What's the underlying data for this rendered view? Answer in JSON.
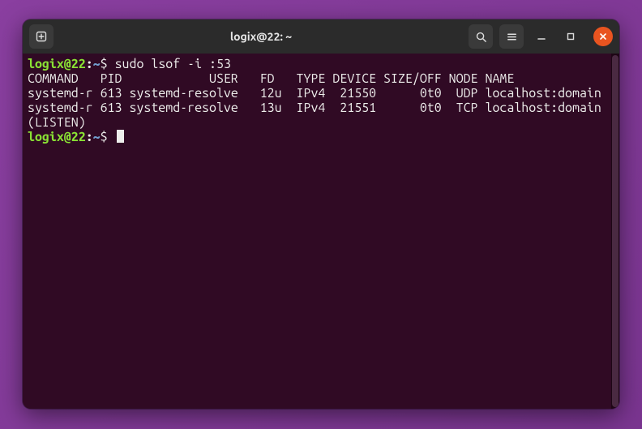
{
  "titlebar": {
    "title": "logix@22: ~"
  },
  "prompt": {
    "user_host": "logix@22",
    "path": "~",
    "symbol": "$"
  },
  "session": {
    "command1": "sudo lsof -i :53",
    "header": "COMMAND   PID            USER   FD   TYPE DEVICE SIZE/OFF NODE NAME",
    "row1": "systemd-r 613 systemd-resolve   12u  IPv4  21550      0t0  UDP localhost:domain",
    "row2": "systemd-r 613 systemd-resolve   13u  IPv4  21551      0t0  TCP localhost:domain",
    "row2b": "(LISTEN)"
  }
}
